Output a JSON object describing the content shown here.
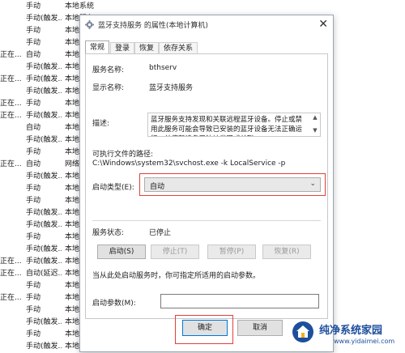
{
  "background_list": {
    "rows": [
      {
        "status": "",
        "startup": "手动",
        "logon": "本地系统"
      },
      {
        "status": "",
        "startup": "手动(触发...",
        "logon": "本地服务"
      },
      {
        "status": "",
        "startup": "手动",
        "logon": "本地系统"
      },
      {
        "status": "",
        "startup": "手动",
        "logon": "本地系统"
      },
      {
        "status": "正在...",
        "startup": "自动",
        "logon": "本地系统"
      },
      {
        "status": "",
        "startup": "手动(触发...",
        "logon": "本地服务"
      },
      {
        "status": "正在...",
        "startup": "手动(触发...",
        "logon": "本地系统"
      },
      {
        "status": "",
        "startup": "手动(触发...",
        "logon": "本地系统"
      },
      {
        "status": "正在...",
        "startup": "手动",
        "logon": "本地系统"
      },
      {
        "status": "正在...",
        "startup": "手动(触发...",
        "logon": "本地服务"
      },
      {
        "status": "",
        "startup": "自动",
        "logon": "本地系统"
      },
      {
        "status": "",
        "startup": "手动(触发...",
        "logon": "本地系统"
      },
      {
        "status": "",
        "startup": "手动",
        "logon": "本地系统"
      },
      {
        "status": "正在...",
        "startup": "自动",
        "logon": "网络服务"
      },
      {
        "status": "",
        "startup": "手动(触发...",
        "logon": "本地系统"
      },
      {
        "status": "",
        "startup": "手动",
        "logon": "本地系统"
      },
      {
        "status": "",
        "startup": "手动",
        "logon": "本地系统"
      },
      {
        "status": "",
        "startup": "手动(触发...",
        "logon": "本地系统"
      },
      {
        "status": "",
        "startup": "手动(触发...",
        "logon": "本地服务"
      },
      {
        "status": "",
        "startup": "手动",
        "logon": "本地系统"
      },
      {
        "status": "",
        "startup": "手动(触发...",
        "logon": "本地系统"
      },
      {
        "status": "正在...",
        "startup": "手动(触发...",
        "logon": "本地系统"
      },
      {
        "status": "正在...",
        "startup": "自动(延迟...",
        "logon": "本地系统"
      },
      {
        "status": "",
        "startup": "手动",
        "logon": "本地系统"
      },
      {
        "status": "正在...",
        "startup": "手动",
        "logon": "本地系统"
      },
      {
        "status": "",
        "startup": "手动",
        "logon": "本地系统"
      },
      {
        "status": "",
        "startup": "手动(触发...",
        "logon": "本地系统"
      },
      {
        "status": "",
        "startup": "手动",
        "logon": "本地系统"
      },
      {
        "status": "",
        "startup": "手动(触发...",
        "logon": "本地系统"
      }
    ]
  },
  "dialog": {
    "title": "蓝牙支持服务 的属性(本地计算机)",
    "close_glyph": "✕",
    "tabs": [
      "常规",
      "登录",
      "恢复",
      "依存关系"
    ],
    "service_name_label": "服务名称:",
    "service_name_value": "bthserv",
    "display_name_label": "显示名称:",
    "display_name_value": "蓝牙支持服务",
    "description_label": "描述:",
    "description_value": "蓝牙服务支持发现和关联远程蓝牙设备。停止或禁用此服务可能会导致已安装的蓝牙设备无法正确运行，并使新设备无法被发现或关联。",
    "exe_path_label": "可执行文件的路径:",
    "exe_path_value": "C:\\Windows\\system32\\svchost.exe -k LocalService -p",
    "startup_type_label": "启动类型(E):",
    "startup_type_value": "自动",
    "service_status_label": "服务状态:",
    "service_status_value": "已停止",
    "buttons": {
      "start": "启动(S)",
      "stop": "停止(T)",
      "pause": "暂停(P)",
      "resume": "恢复(R)"
    },
    "hint": "当从此处启动服务时，你可指定所适用的启动参数。",
    "start_params_label": "启动参数(M):",
    "start_params_value": "",
    "ok": "确定",
    "cancel": "取消"
  },
  "watermark": {
    "text": "纯净系统家园",
    "url": "www.yidaimei.com"
  },
  "colors": {
    "highlight": "#e0403a",
    "watermark": "#1d4f9c"
  }
}
